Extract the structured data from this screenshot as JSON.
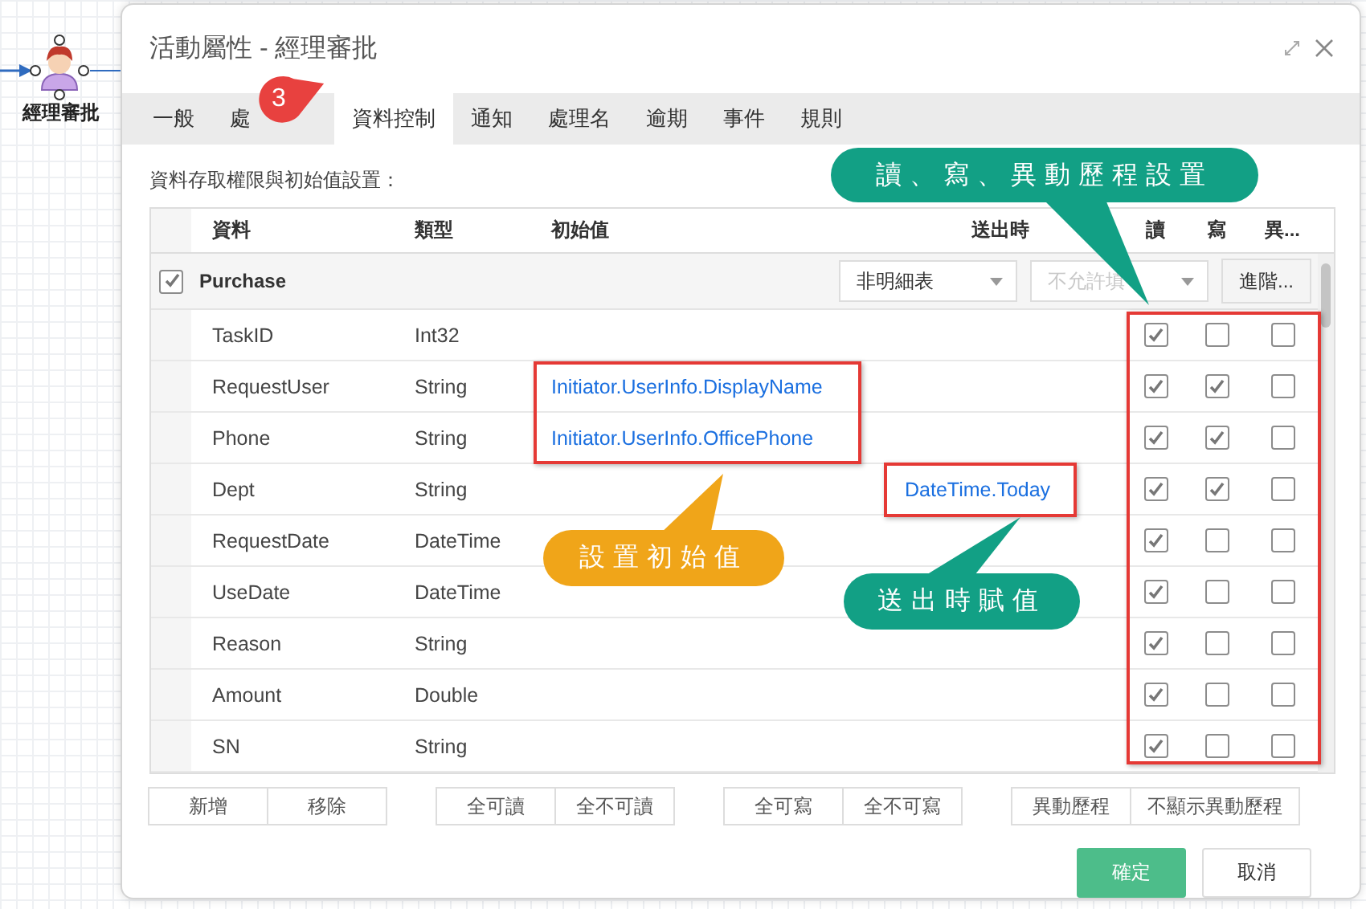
{
  "canvas": {
    "node_label": "經理審批"
  },
  "dialog": {
    "title": "活動屬性 - 經理審批",
    "tabs": [
      {
        "label": "一般",
        "selected": false
      },
      {
        "label": "處",
        "selected": false
      },
      {
        "label": "資料控制",
        "selected": true
      },
      {
        "label": "通知",
        "selected": false
      },
      {
        "label": "處理名",
        "selected": false
      },
      {
        "label": "逾期",
        "selected": false
      },
      {
        "label": "事件",
        "selected": false
      },
      {
        "label": "規則",
        "selected": false
      }
    ],
    "section_label": "資料存取權限與初始值設置：",
    "table": {
      "columns": [
        "資料",
        "類型",
        "初始值",
        "送出時",
        "讀",
        "寫",
        "異..."
      ],
      "group": {
        "name": "Purchase",
        "checked": true,
        "send_select": "非明細表",
        "write_select": {
          "value": "不允許填",
          "disabled": true
        },
        "advanced_button": "進階..."
      },
      "rows": [
        {
          "name": "TaskID",
          "type": "Int32",
          "read": true,
          "write": false,
          "history": false
        },
        {
          "name": "RequestUser",
          "type": "String",
          "initial": "Initiator.UserInfo.DisplayName",
          "read": true,
          "write": true,
          "history": false
        },
        {
          "name": "Phone",
          "type": "String",
          "initial": "Initiator.UserInfo.OfficePhone",
          "read": true,
          "write": true,
          "history": false
        },
        {
          "name": "Dept",
          "type": "String",
          "on_send": "DateTime.Today",
          "read": true,
          "write": true,
          "history": false
        },
        {
          "name": "RequestDate",
          "type": "DateTime",
          "read": true,
          "write": false,
          "history": false
        },
        {
          "name": "UseDate",
          "type": "DateTime",
          "read": true,
          "write": false,
          "history": false
        },
        {
          "name": "Reason",
          "type": "String",
          "read": true,
          "write": false,
          "history": false
        },
        {
          "name": "Amount",
          "type": "Double",
          "read": true,
          "write": false,
          "history": false
        },
        {
          "name": "SN",
          "type": "String",
          "read": true,
          "write": false,
          "history": false
        }
      ]
    },
    "button_groups": [
      [
        "新增",
        "移除"
      ],
      [
        "全可讀",
        "全不可讀"
      ],
      [
        "全可寫",
        "全不可寫"
      ],
      [
        "異動歷程",
        "不顯示異動歷程"
      ]
    ],
    "footer": {
      "ok": "確定",
      "cancel": "取消"
    }
  },
  "annotations": [
    {
      "kind": "step",
      "text": "3",
      "color": "#e8413f"
    },
    {
      "kind": "callout",
      "text": "讀、寫、異動歷程設置",
      "color": "#12a085"
    },
    {
      "kind": "callout",
      "text": "設置初始值",
      "color": "#f0a519"
    },
    {
      "kind": "callout",
      "text": "送出時賦值",
      "color": "#12a085"
    }
  ]
}
